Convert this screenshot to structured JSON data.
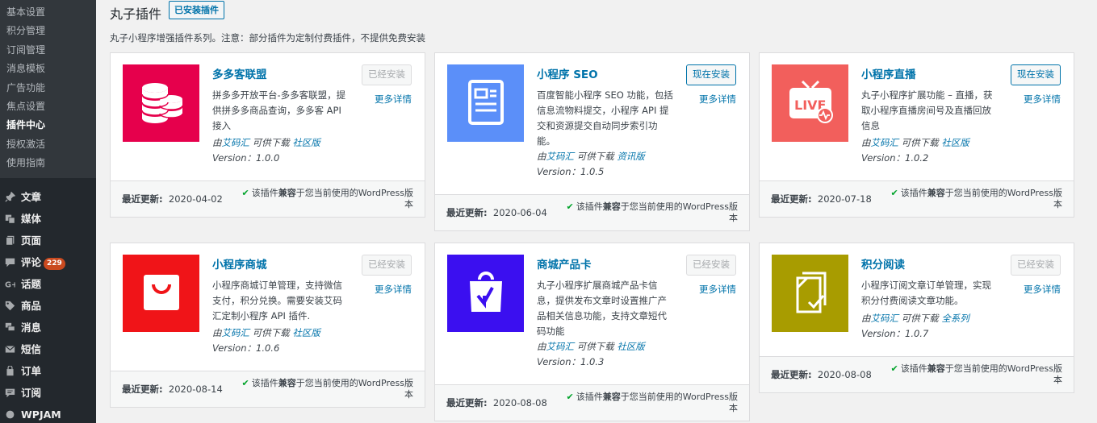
{
  "sidebar": {
    "submenu": [
      "基本设置",
      "积分管理",
      "订阅管理",
      "消息模板",
      "广告功能",
      "焦点设置",
      "插件中心",
      "授权激活",
      "使用指南"
    ],
    "current_submenu": "插件中心",
    "menu": [
      {
        "label": "文章",
        "icon": "pin-icon"
      },
      {
        "label": "媒体",
        "icon": "media-icon"
      },
      {
        "label": "页面",
        "icon": "page-icon"
      },
      {
        "label": "评论",
        "icon": "comment-icon",
        "badge": "229"
      },
      {
        "label": "话题",
        "icon": "topic-icon"
      },
      {
        "label": "商品",
        "icon": "tag-icon"
      },
      {
        "label": "消息",
        "icon": "message-icon"
      },
      {
        "label": "短信",
        "icon": "sms-icon"
      },
      {
        "label": "订单",
        "icon": "cart-icon"
      },
      {
        "label": "订阅",
        "icon": "subscribe-icon"
      },
      {
        "label": "WPJAM",
        "icon": "wpjam-icon"
      }
    ]
  },
  "header": {
    "title": "丸子插件",
    "installed_tab": "已安装插件",
    "description": "丸子小程序增强插件系列。注意：部分插件为定制付费插件，不提供免费安装"
  },
  "labels": {
    "more": "更多详情",
    "last_updated": "最近更新:",
    "compat_prefix": "该插件",
    "compat_bold": "兼容",
    "compat_suffix": "于您当前使用的WordPress版本",
    "by": "由",
    "available": "可供下载",
    "version_prefix": "Version："
  },
  "plugins": [
    {
      "name": "多多客联盟",
      "desc": "拼多多开放平台-多多客联盟，提供拼多多商品查询，多多客 API 接入",
      "author": "艾码汇",
      "channel": "社区版",
      "version": "1.0.0",
      "action": "已经安装",
      "installed": true,
      "updated": "2020-04-02",
      "color": "#e6004c",
      "icon": "coins-icon"
    },
    {
      "name": "小程序 SEO",
      "desc": "百度智能小程序 SEO 功能，包括信息流物料提交，小程序 API 提交和资源提交自动同步索引功能。",
      "author": "艾码汇",
      "channel": "资讯版",
      "version": "1.0.5",
      "action": "现在安装",
      "installed": false,
      "updated": "2020-06-04",
      "color": "#5b8ff9",
      "icon": "document-icon"
    },
    {
      "name": "小程序直播",
      "desc": "丸子小程序扩展功能 – 直播，获取小程序直播房间号及直播回放信息",
      "author": "艾码汇",
      "channel": "社区版",
      "version": "1.0.2",
      "action": "现在安装",
      "installed": false,
      "updated": "2020-07-18",
      "color": "#f25f5c",
      "icon": "live-tv-icon"
    },
    {
      "name": "小程序商城",
      "desc": "小程序商城订单管理，支持微信支付，积分兑换。需要安装艾码汇定制小程序 API 插件.",
      "author": "艾码汇",
      "channel": "社区版",
      "version": "1.0.6",
      "action": "已经安装",
      "installed": true,
      "updated": "2020-08-14",
      "color": "#f01418",
      "icon": "shopping-bag-icon"
    },
    {
      "name": "商城产品卡",
      "desc": "丸子小程序扩展商城产品卡信息，提供发布文章时设置推广产品相关信息功能，支持文章短代码功能",
      "author": "艾码汇",
      "channel": "社区版",
      "version": "1.0.3",
      "action": "已经安装",
      "installed": true,
      "updated": "2020-08-08",
      "color": "#3b0ff0",
      "icon": "product-bag-icon"
    },
    {
      "name": "积分阅读",
      "desc": "小程序订阅文章订单管理，实现积分付费阅读文章功能。",
      "author": "艾码汇",
      "channel": "全系列",
      "version": "1.0.7",
      "action": "已经安装",
      "installed": true,
      "updated": "2020-08-08",
      "color": "#a89c00",
      "icon": "document-check-icon"
    }
  ]
}
